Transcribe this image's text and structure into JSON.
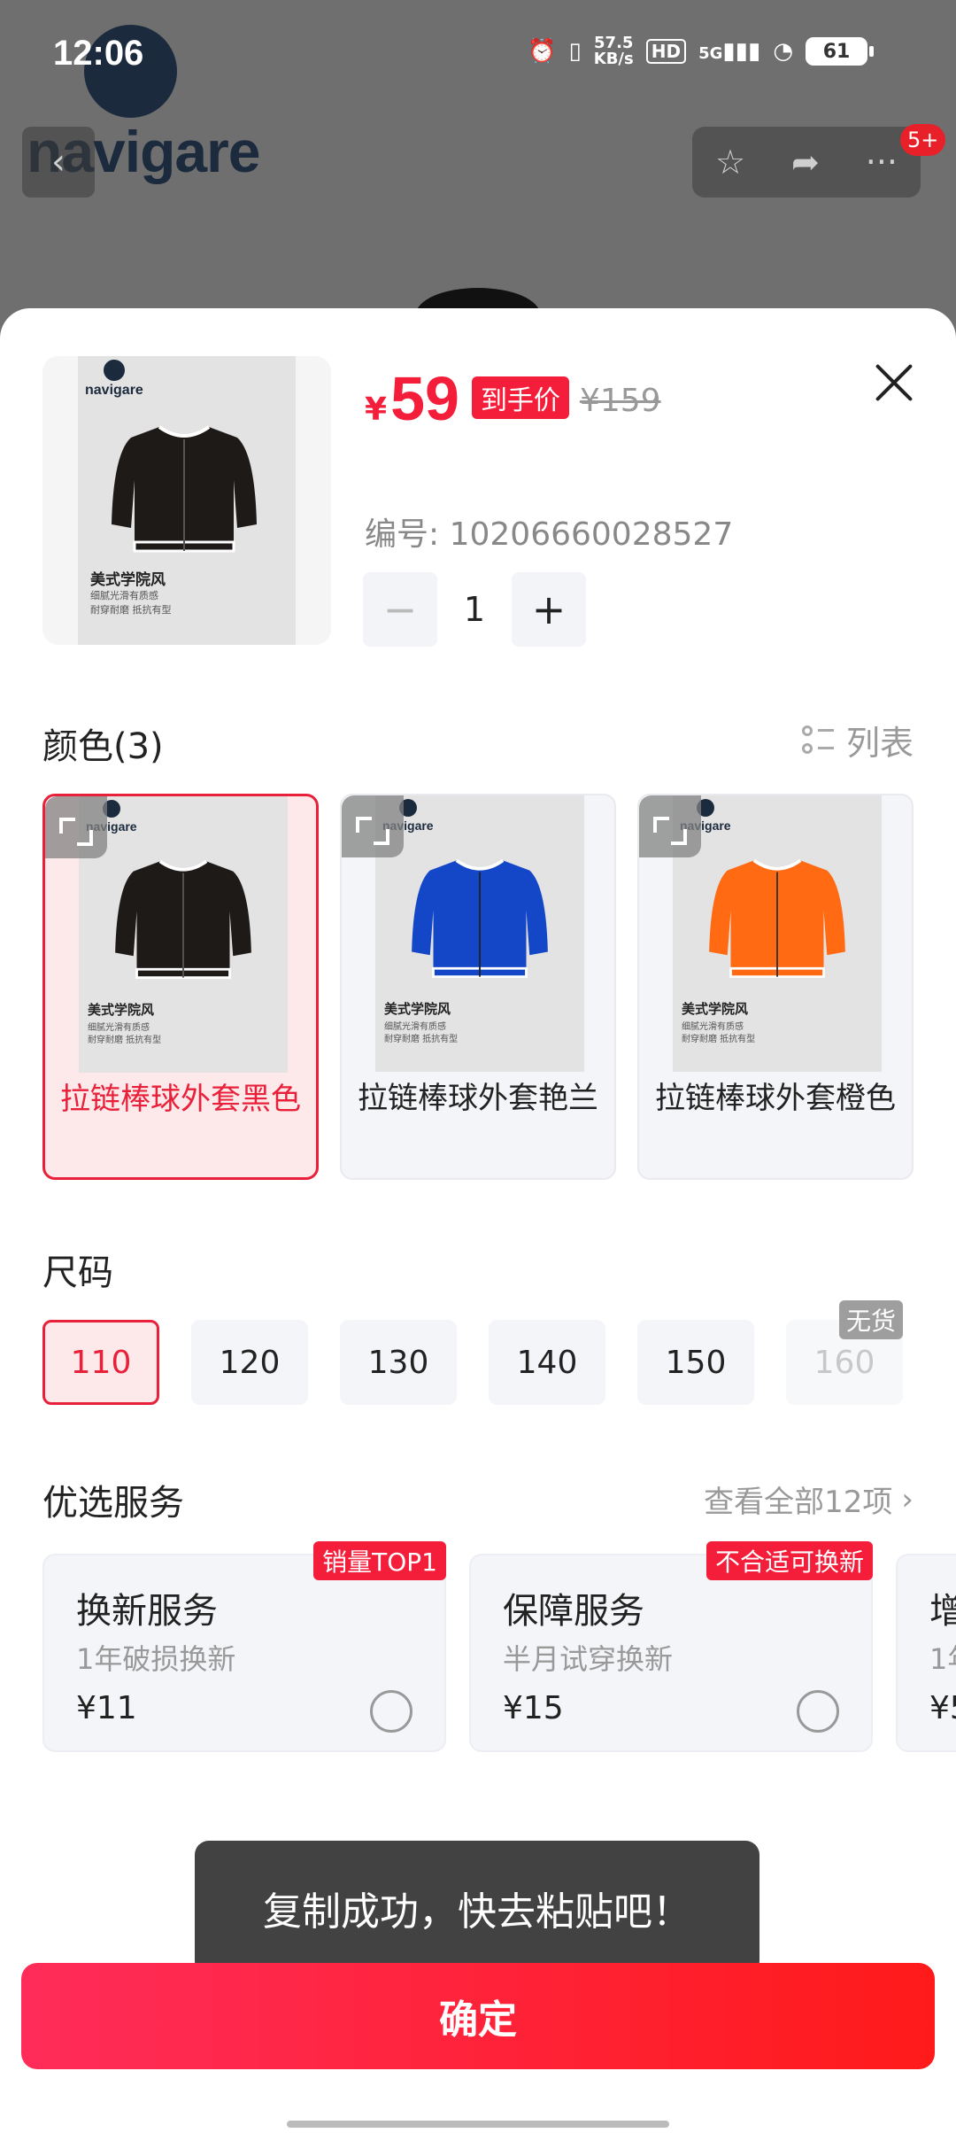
{
  "status_bar": {
    "time": "12:06",
    "net_speed": "57.5",
    "net_unit": "KB/s",
    "hd": "HD",
    "signal": "5G",
    "battery": "61"
  },
  "brand": {
    "name": "navigare"
  },
  "header": {
    "cart_badge": "5+"
  },
  "product": {
    "price_symbol": "¥",
    "price": "59",
    "price_tag": "到手价",
    "original_price": "¥159",
    "sku": "编号: 10206660028527",
    "quantity": "1",
    "image_caption": "美式学院风",
    "image_sub1": "细腻光滑有质感",
    "image_sub2": "耐穿耐磨 抵抗有型"
  },
  "colors": {
    "title": "颜色(3)",
    "view_toggle": "列表",
    "items": [
      {
        "name": "拉链棒球外套黑色",
        "hex": "#1e1a18"
      },
      {
        "name": "拉链棒球外套艳兰",
        "hex": "#1446c8"
      },
      {
        "name": "拉链棒球外套橙色",
        "hex": "#ff6a12"
      }
    ]
  },
  "sizes": {
    "title": "尺码",
    "items": [
      "110",
      "120",
      "130",
      "140",
      "150",
      "160"
    ],
    "out_of_stock_label": "无货"
  },
  "services": {
    "title": "优选服务",
    "view_all": "查看全部12项",
    "items": [
      {
        "title": "换新服务",
        "desc": "1年破损换新",
        "price": "¥11",
        "badge": "销量TOP1"
      },
      {
        "title": "保障服务",
        "desc": "半月试穿换新",
        "price": "¥15",
        "badge": "不合适可换新"
      },
      {
        "title": "增",
        "desc": "1年",
        "price": "¥5"
      }
    ]
  },
  "toast": "复制成功，快去粘贴吧！",
  "confirm_label": "确定"
}
